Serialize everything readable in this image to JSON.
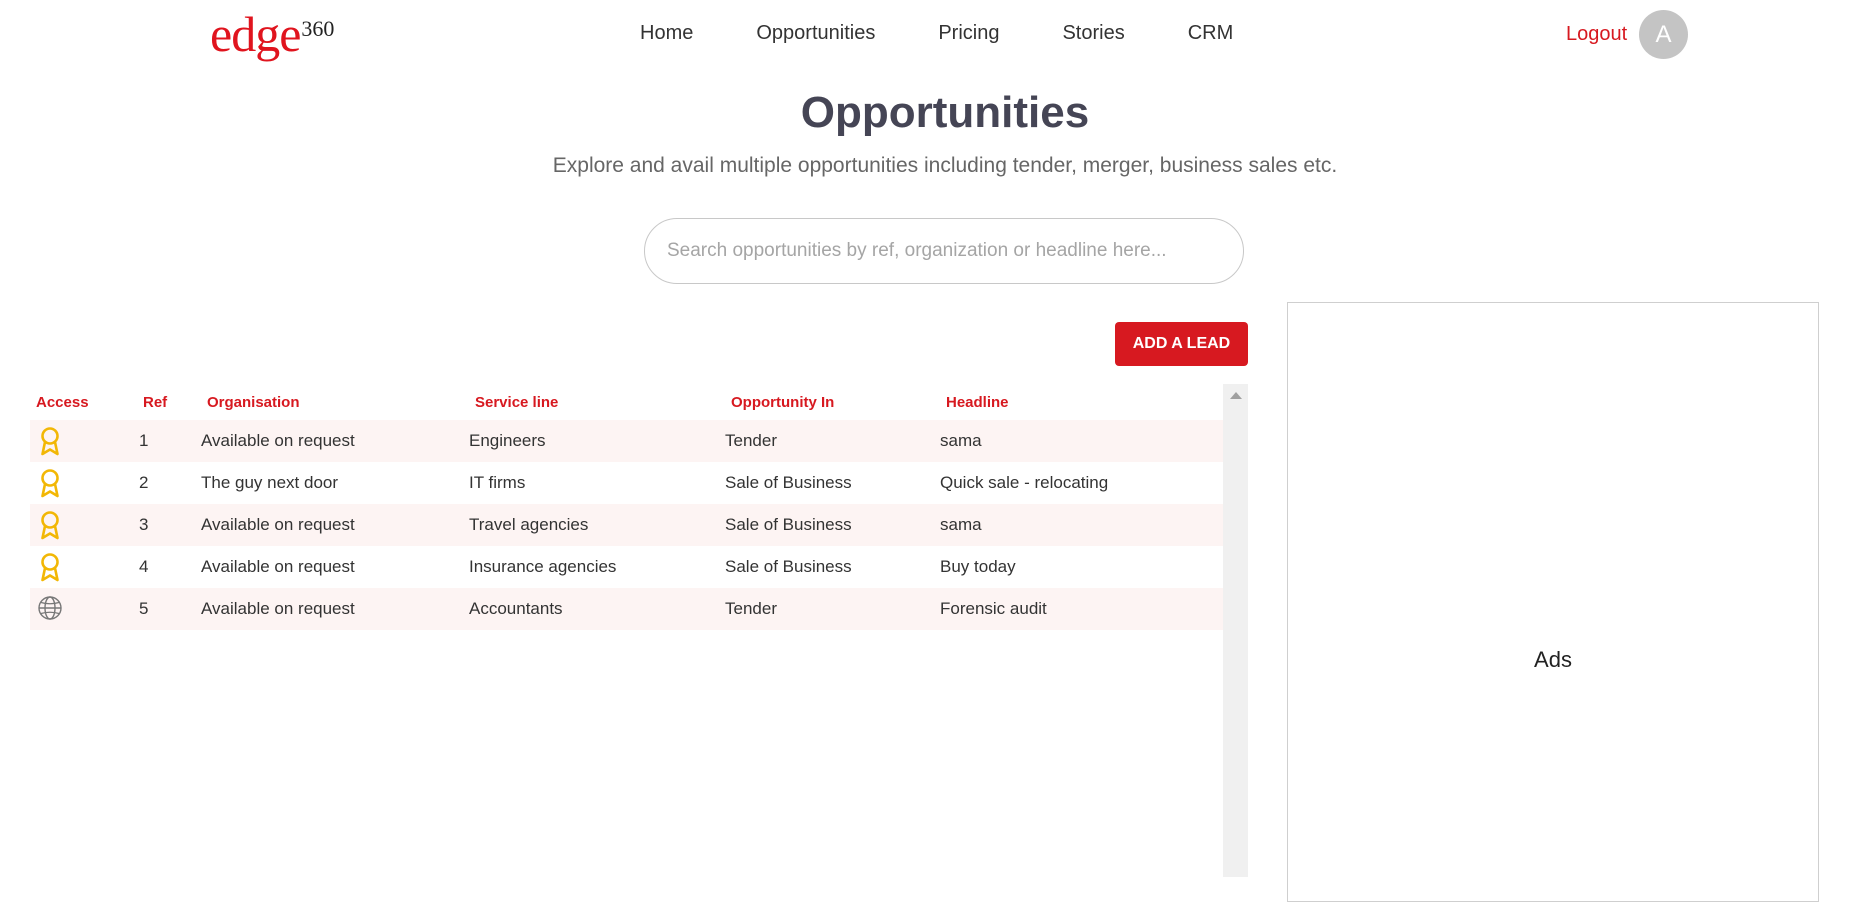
{
  "header": {
    "logo": {
      "main": "edge",
      "sup": "360"
    },
    "nav": [
      {
        "label": "Home"
      },
      {
        "label": "Opportunities"
      },
      {
        "label": "Pricing"
      },
      {
        "label": "Stories"
      },
      {
        "label": "CRM"
      }
    ],
    "logout_label": "Logout",
    "avatar_initial": "A"
  },
  "hero": {
    "title": "Opportunities",
    "subtitle": "Explore and avail multiple opportunities including tender, merger, business sales etc."
  },
  "search": {
    "placeholder": "Search opportunities by ref, organization or headline here...",
    "value": ""
  },
  "actions": {
    "add_lead_label": "ADD A LEAD"
  },
  "table": {
    "columns": [
      "Access",
      "Ref",
      "Organisation",
      "Service line",
      "Opportunity In",
      "Headline"
    ],
    "rows": [
      {
        "access": "ribbon-icon",
        "ref": "1",
        "organisation": "Available on request",
        "service_line": "Engineers",
        "opportunity_in": "Tender",
        "headline": "sama"
      },
      {
        "access": "ribbon-icon",
        "ref": "2",
        "organisation": "The guy next door",
        "service_line": "IT firms",
        "opportunity_in": "Sale of Business",
        "headline": "Quick sale - relocating"
      },
      {
        "access": "ribbon-icon",
        "ref": "3",
        "organisation": "Available on request",
        "service_line": "Travel agencies",
        "opportunity_in": "Sale of Business",
        "headline": "sama"
      },
      {
        "access": "ribbon-icon",
        "ref": "4",
        "organisation": "Available on request",
        "service_line": "Insurance agencies",
        "opportunity_in": "Sale of Business",
        "headline": "Buy today"
      },
      {
        "access": "globe-icon",
        "ref": "5",
        "organisation": "Available on request",
        "service_line": "Accountants",
        "opportunity_in": "Tender",
        "headline": "Forensic audit"
      }
    ]
  },
  "ads": {
    "label": "Ads"
  },
  "colors": {
    "accent": "#d71920",
    "ribbon": "#f2b705",
    "row_alt": "#fdf4f3"
  }
}
